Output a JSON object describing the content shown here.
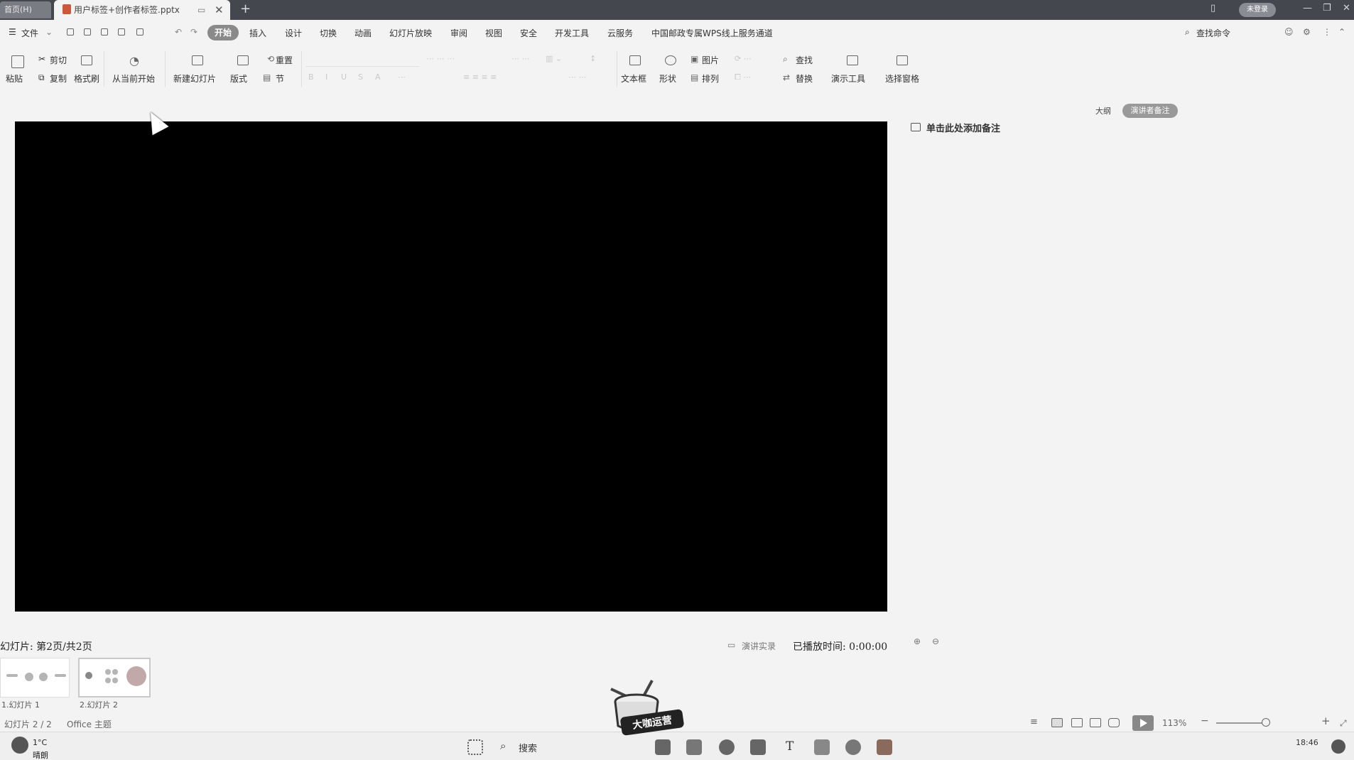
{
  "titlebar": {
    "home_tab": "首页(H)",
    "doc_tab": "用户标签+创作者标签.pptx",
    "login": "未登录",
    "new_tab_symbol": "+"
  },
  "menu": {
    "file": "文件",
    "tabs": [
      "开始",
      "插入",
      "设计",
      "切换",
      "动画",
      "幻灯片放映",
      "审阅",
      "视图",
      "安全",
      "开发工具",
      "云服务",
      "中国邮政专属WPS线上服务通道"
    ],
    "search_cmd": "查找命令"
  },
  "ribbon": {
    "paste": "粘贴",
    "cut": "剪切",
    "copy": "复制",
    "format_painter": "格式刷",
    "from_start": "从当前开始",
    "new_slide": "新建幻灯片",
    "layout": "版式",
    "section": "节",
    "reset": "重置",
    "textbox": "文本框",
    "shape": "形状",
    "picture": "图片",
    "arrange": "排列",
    "find": "查找",
    "replace": "替换",
    "presenter_tools": "演示工具",
    "selection_pane": "选择窗格"
  },
  "right_panel": {
    "outline": "大纲",
    "speaker_notes": "演讲者备注",
    "notes_placeholder": "单击此处添加备注"
  },
  "bottom": {
    "slide_counter": "幻灯片: 第2页/共2页",
    "record": "演讲实录",
    "played_time": "已播放时间: 0:00:00",
    "thumb1_label": "1.幻灯片 1",
    "thumb2_label": "2.幻灯片 2"
  },
  "statusbar": {
    "slide_status": "幻灯片 2 / 2",
    "theme": "Office 主题",
    "zoom": "113%"
  },
  "taskbar": {
    "temperature": "1°C",
    "weather": "晴朗",
    "search": "搜索",
    "time": "18:46"
  },
  "colors": {
    "titlebar": "#45474f",
    "slide_bg": "#000000",
    "app_bg": "#f3f3f3",
    "accent_pill": "#8a8a8a"
  }
}
